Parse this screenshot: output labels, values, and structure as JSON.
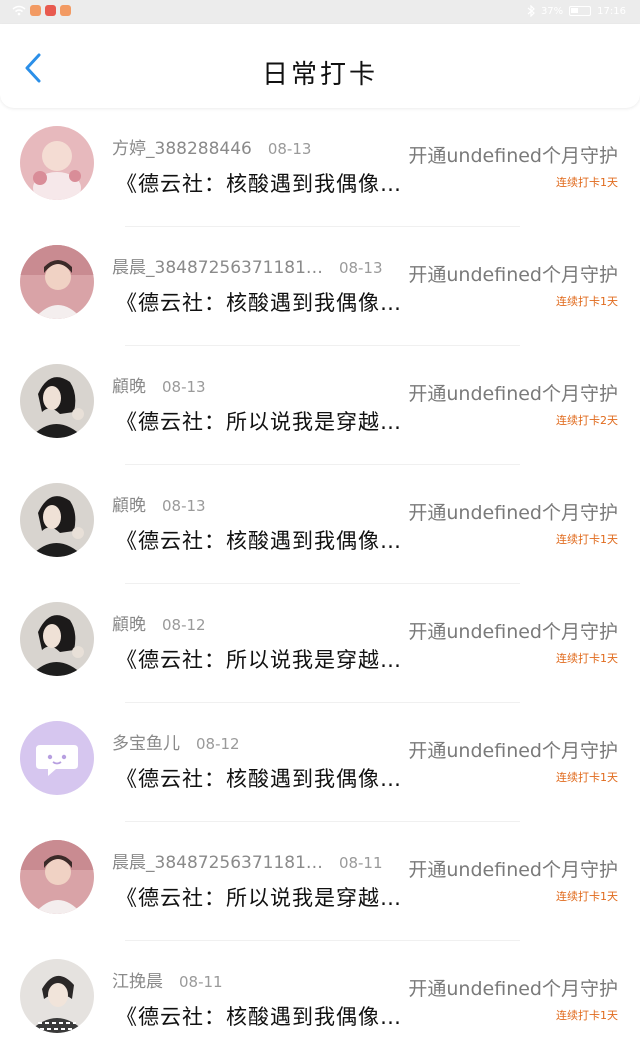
{
  "status_bar": {
    "time": "17:16",
    "battery_level": "37%"
  },
  "header": {
    "title": "日常打卡"
  },
  "items": [
    {
      "name": "方婷_388288446",
      "date": "08-13",
      "message": "《德云社：核酸遇到我偶像…",
      "action": "开通undefined个月守护",
      "streak": "连续打卡1天"
    },
    {
      "name": "晨晨_38487256371181…",
      "date": "08-13",
      "message": "《德云社：核酸遇到我偶像…",
      "action": "开通undefined个月守护",
      "streak": "连续打卡1天"
    },
    {
      "name": "顧晚",
      "date": "08-13",
      "message": "《德云社：所以说我是穿越…",
      "action": "开通undefined个月守护",
      "streak": "连续打卡2天"
    },
    {
      "name": "顧晚",
      "date": "08-13",
      "message": "《德云社：核酸遇到我偶像…",
      "action": "开通undefined个月守护",
      "streak": "连续打卡1天"
    },
    {
      "name": "顧晚",
      "date": "08-12",
      "message": "《德云社：所以说我是穿越…",
      "action": "开通undefined个月守护",
      "streak": "连续打卡1天"
    },
    {
      "name": "多宝鱼儿",
      "date": "08-12",
      "message": "《德云社：核酸遇到我偶像…",
      "action": "开通undefined个月守护",
      "streak": "连续打卡1天"
    },
    {
      "name": "晨晨_38487256371181…",
      "date": "08-11",
      "message": "《德云社：所以说我是穿越…",
      "action": "开通undefined个月守护",
      "streak": "连续打卡1天"
    },
    {
      "name": "江挽晨",
      "date": "08-11",
      "message": "《德云社：核酸遇到我偶像…",
      "action": "开通undefined个月守护",
      "streak": "连续打卡1天"
    }
  ],
  "colors": {
    "accent_blue": "#2b8fe8",
    "streak_orange": "#e06a1c"
  }
}
